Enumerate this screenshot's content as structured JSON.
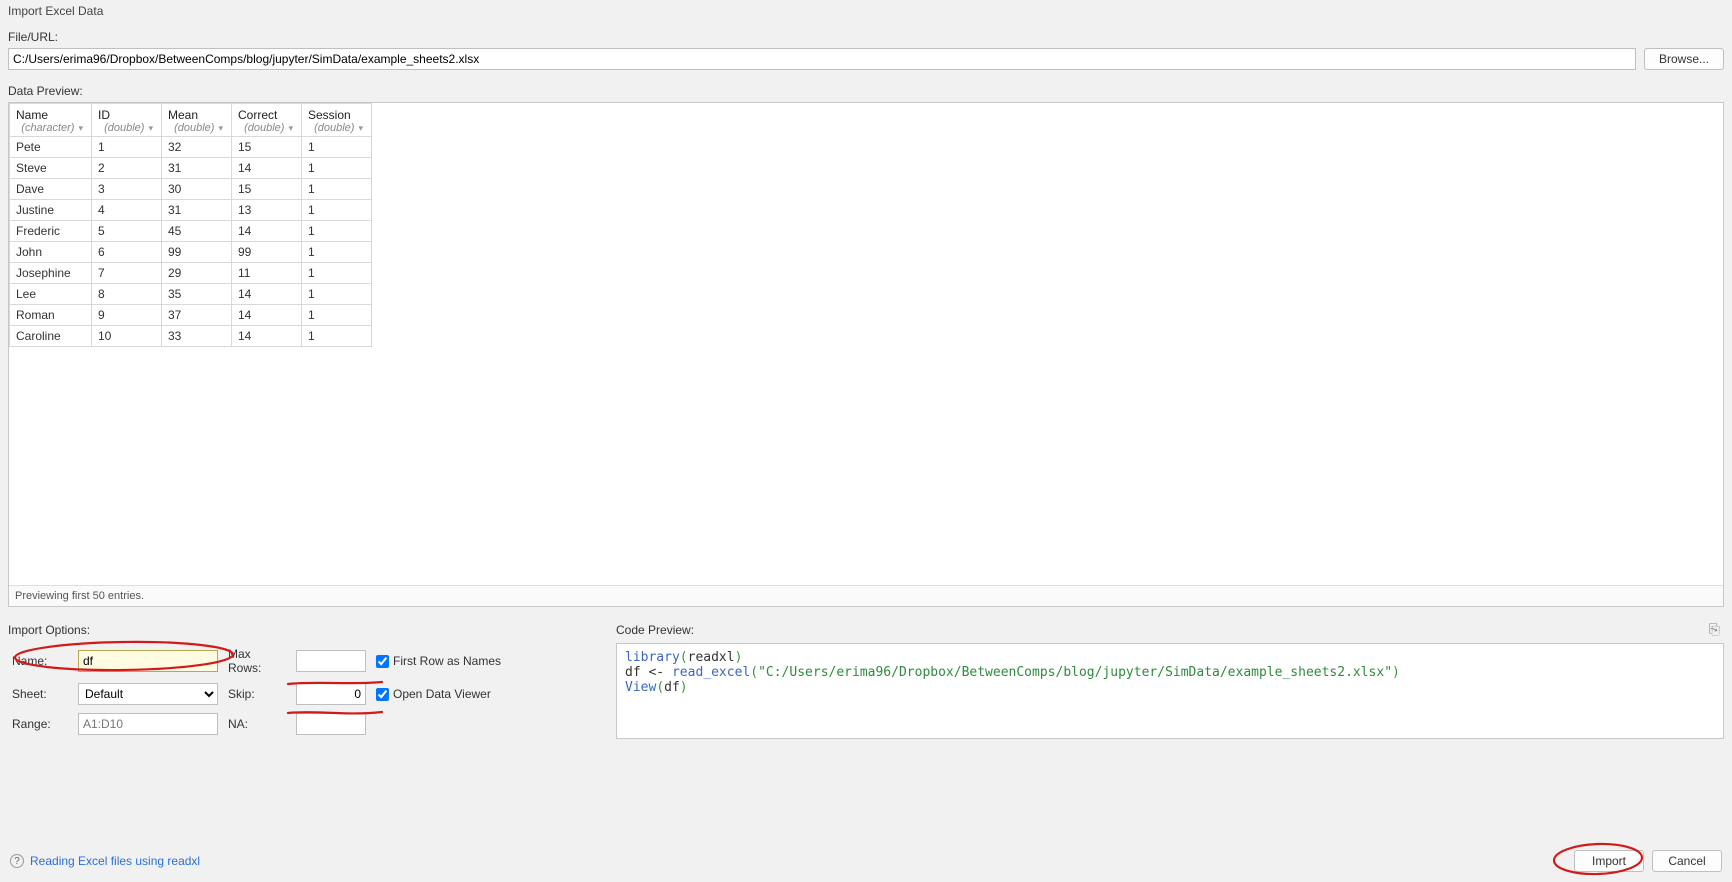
{
  "dialog": {
    "title": "Import Excel Data"
  },
  "file": {
    "label": "File/URL:",
    "value": "C:/Users/erima96/Dropbox/BetweenComps/blog/jupyter/SimData/example_sheets2.xlsx",
    "browse": "Browse..."
  },
  "preview": {
    "label": "Data Preview:",
    "status": "Previewing first 50 entries.",
    "columns": [
      {
        "title": "Name",
        "type": "(character)"
      },
      {
        "title": "ID",
        "type": "(double)"
      },
      {
        "title": "Mean",
        "type": "(double)"
      },
      {
        "title": "Correct",
        "type": "(double)"
      },
      {
        "title": "Session",
        "type": "(double)"
      }
    ],
    "rows": [
      [
        "Pete",
        "1",
        "32",
        "15",
        "1"
      ],
      [
        "Steve",
        "2",
        "31",
        "14",
        "1"
      ],
      [
        "Dave",
        "3",
        "30",
        "15",
        "1"
      ],
      [
        "Justine",
        "4",
        "31",
        "13",
        "1"
      ],
      [
        "Frederic",
        "5",
        "45",
        "14",
        "1"
      ],
      [
        "John",
        "6",
        "99",
        "99",
        "1"
      ],
      [
        "Josephine",
        "7",
        "29",
        "11",
        "1"
      ],
      [
        "Lee",
        "8",
        "35",
        "14",
        "1"
      ],
      [
        "Roman",
        "9",
        "37",
        "14",
        "1"
      ],
      [
        "Caroline",
        "10",
        "33",
        "14",
        "1"
      ]
    ]
  },
  "options": {
    "label": "Import Options:",
    "name_label": "Name:",
    "name_value": "df",
    "sheet_label": "Sheet:",
    "sheet_value": "Default",
    "range_label": "Range:",
    "range_placeholder": "A1:D10",
    "maxrows_label": "Max Rows:",
    "maxrows_value": "",
    "skip_label": "Skip:",
    "skip_value": "0",
    "na_label": "NA:",
    "na_value": "",
    "firstrow_label": "First Row as Names",
    "openviewer_label": "Open Data Viewer"
  },
  "code": {
    "label": "Code Preview:",
    "line1_fn": "library",
    "line1_arg": "readxl",
    "line2_lhs": "df <- ",
    "line2_fn": "read_excel",
    "line2_str": "\"C:/Users/erima96/Dropbox/BetweenComps/blog/jupyter/SimData/example_sheets2.xlsx\"",
    "line3": "View",
    "line3_arg": "df"
  },
  "footer": {
    "help_text": "Reading Excel files using readxl",
    "import": "Import",
    "cancel": "Cancel"
  }
}
